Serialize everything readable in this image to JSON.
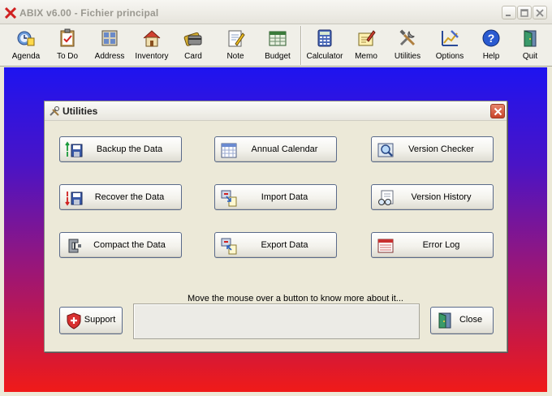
{
  "window": {
    "title": "ABIX v6.00  -  Fichier principal",
    "icon": "abix-x-icon",
    "controls": [
      "minimize-icon",
      "maximize-icon",
      "close-icon"
    ]
  },
  "toolbar": {
    "items": [
      {
        "label": "Agenda",
        "icon": "agenda-icon"
      },
      {
        "label": "To Do",
        "icon": "todo-clipboard-icon"
      },
      {
        "label": "Address",
        "icon": "address-book-icon"
      },
      {
        "label": "Inventory",
        "icon": "house-icon"
      },
      {
        "label": "Card",
        "icon": "card-icon"
      },
      {
        "label": "Note",
        "icon": "note-pencil-icon"
      },
      {
        "label": "Budget",
        "icon": "budget-icon"
      },
      {
        "label": "Calculator",
        "icon": "calculator-icon"
      },
      {
        "label": "Memo",
        "icon": "memo-icon"
      },
      {
        "label": "Utilities",
        "icon": "tools-icon"
      },
      {
        "label": "Options",
        "icon": "options-icon"
      },
      {
        "label": "Help",
        "icon": "help-icon"
      },
      {
        "label": "Quit",
        "icon": "quit-door-icon"
      }
    ]
  },
  "dialog": {
    "title": "Utilities",
    "buttons": {
      "backup": "Backup the Data",
      "recover": "Recover the Data",
      "compact": "Compact the Data",
      "annual_calendar": "Annual Calendar",
      "import": "Import Data",
      "export": "Export Data",
      "version_checker": "Version Checker",
      "version_history": "Version History",
      "error_log": "Error Log",
      "support": "Support",
      "close": "Close"
    },
    "hint": "Move the mouse over a button to know more about it...",
    "info_text": ""
  }
}
